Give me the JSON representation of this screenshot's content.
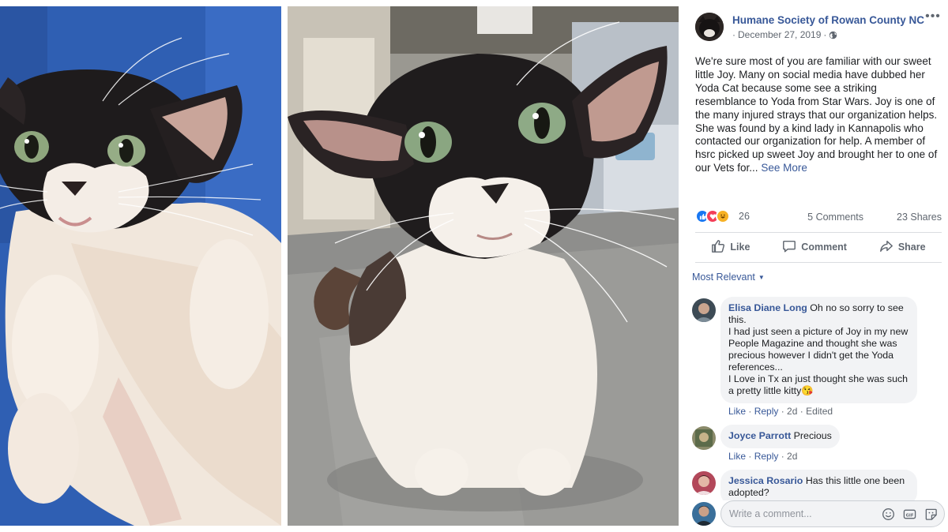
{
  "post": {
    "page_name": "Humane Society of Rowan County NC",
    "date": "December 27, 2019",
    "separator": "·",
    "text": "We're sure most of you are familiar with our sweet little Joy. Many on social media have dubbed her Yoda Cat because some see a striking resemblance to Yoda from Star Wars. Joy is one of the many injured strays that our organization helps. She was found by a kind lady in Kannapolis who contacted our organization for help. A member of hsrc picked up sweet Joy and brought her to one of our Vets for...",
    "see_more": "See More"
  },
  "reactions": {
    "icons": [
      "like",
      "love",
      "haha"
    ],
    "count": "26",
    "comments": "5 Comments",
    "shares": "23 Shares"
  },
  "actions": {
    "like": "Like",
    "comment": "Comment",
    "share": "Share"
  },
  "filter": {
    "label": "Most Relevant"
  },
  "comments": [
    {
      "name": "Elisa Diane Long",
      "text_first": "Oh no so sorry to see this.",
      "text_lines": [
        "I had just seen a picture of Joy in my new People Magazine and thought she was precious however I didn't get the Yoda references...",
        "I Love in Tx an just thought she was such a pretty little kitty😘"
      ],
      "like": "Like",
      "reply": "Reply",
      "time": "2d",
      "edited": "Edited"
    },
    {
      "name": "Joyce Parrott",
      "text_first": "Precious",
      "like": "Like",
      "reply": "Reply",
      "time": "2d"
    },
    {
      "name": "Jessica Rosario",
      "text_first": "Has this little one been adopted?"
    }
  ],
  "compose": {
    "placeholder": "Write a comment..."
  },
  "colors": {
    "link": "#385898",
    "secondary_text": "#606770",
    "bubble": "#f2f3f5",
    "like_blue": "#1877f2",
    "love_red": "#f33e58",
    "haha_yellow": "#f7b125"
  }
}
